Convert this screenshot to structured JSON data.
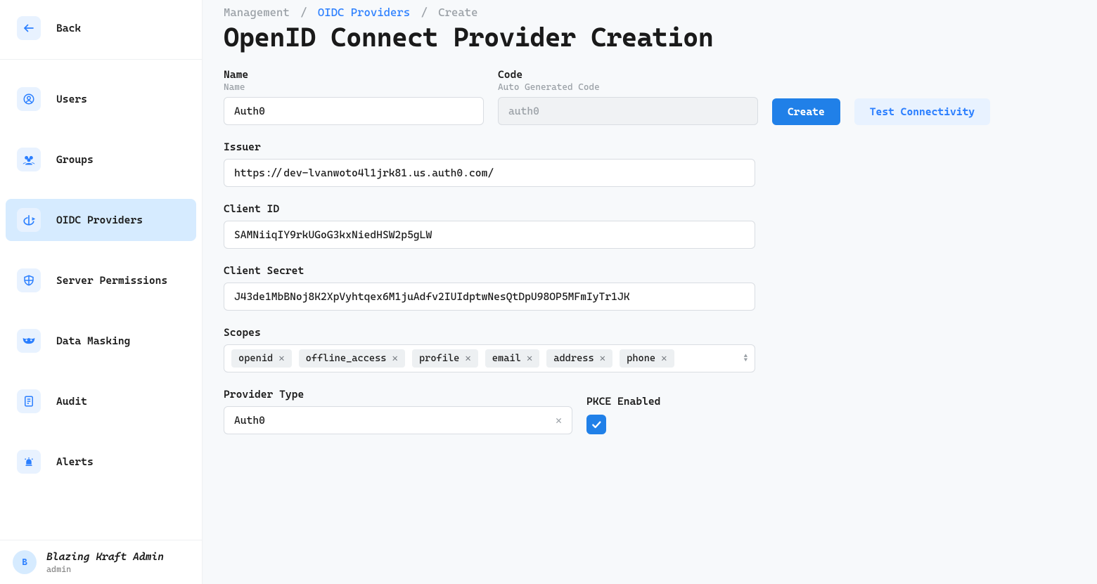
{
  "sidebar": {
    "back": "Back",
    "items": [
      {
        "label": "Users",
        "icon": "user-icon"
      },
      {
        "label": "Groups",
        "icon": "group-icon"
      },
      {
        "label": "OIDC Providers",
        "icon": "oidc-icon",
        "active": true
      },
      {
        "label": "Server Permissions",
        "icon": "shield-icon"
      },
      {
        "label": "Data Masking",
        "icon": "mask-icon"
      },
      {
        "label": "Audit",
        "icon": "audit-icon"
      },
      {
        "label": "Alerts",
        "icon": "alert-icon"
      }
    ]
  },
  "user": {
    "initial": "B",
    "name": "Blazing Kraft Admin",
    "role": "admin"
  },
  "breadcrumb": {
    "a": "Management",
    "b": "OIDC Providers",
    "c": "Create"
  },
  "page_title": "OpenID Connect Provider Creation",
  "buttons": {
    "create": "Create",
    "test": "Test Connectivity"
  },
  "fields": {
    "name": {
      "label": "Name",
      "sublabel": "Name",
      "value": "Auth0"
    },
    "code": {
      "label": "Code",
      "sublabel": "Auto Generated Code",
      "value": "auth0"
    },
    "issuer": {
      "label": "Issuer",
      "value": "https://dev-lvanwoto4l1jrk81.us.auth0.com/"
    },
    "client_id": {
      "label": "Client ID",
      "value": "SAMNiiqIY9rkUGoG3kxNiedHSW2p5gLW"
    },
    "client_secret": {
      "label": "Client Secret",
      "value": "J43de1MbBNoj8K2XpVyhtqex6M1juAdfv2IUIdptwNesQtDpU98OP5MFmIyTr1JK"
    },
    "scopes": {
      "label": "Scopes",
      "values": [
        "openid",
        "offline_access",
        "profile",
        "email",
        "address",
        "phone"
      ]
    },
    "provider_type": {
      "label": "Provider Type",
      "value": "Auth0"
    },
    "pkce": {
      "label": "PKCE Enabled",
      "checked": true
    }
  }
}
